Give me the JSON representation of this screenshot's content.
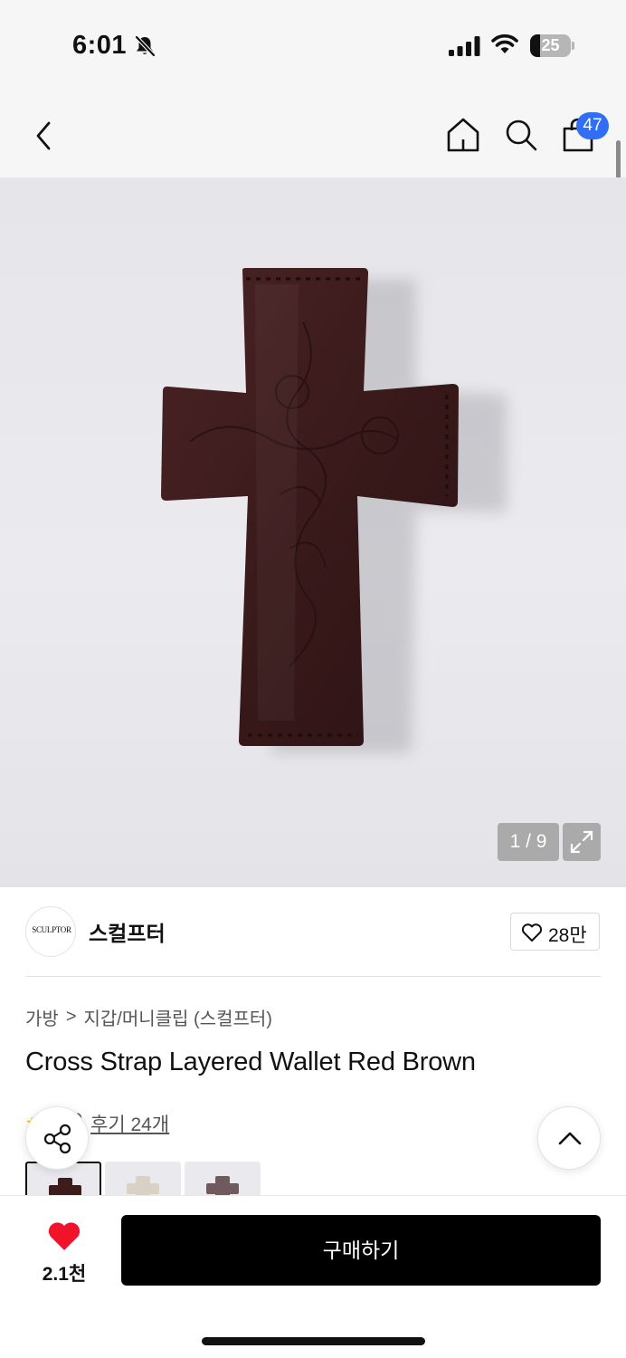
{
  "status_bar": {
    "time": "6:01",
    "battery_level": "25",
    "icons": [
      "bell-slash-icon",
      "cellular-signal-icon",
      "wifi-icon",
      "battery-icon"
    ]
  },
  "nav": {
    "icons": [
      "back-chevron-icon",
      "home-icon",
      "search-icon",
      "shopping-bag-icon"
    ],
    "cart_count": "47"
  },
  "gallery": {
    "pager": "1 / 9",
    "current_index": 1,
    "total": 9,
    "expand_icon": "expand-icon",
    "thumbnail_colors": [
      "#3e1c1c",
      "#d9d2c4",
      "#6f5a5e"
    ]
  },
  "brand": {
    "logo_text": "SCULPTOR",
    "name": "스컬프터",
    "likes": "28만",
    "like_icon": "heart-outline-icon"
  },
  "breadcrumb": {
    "category": "가방",
    "separator": ">",
    "subcategory": "지갑/머니클립 (스컬프터)"
  },
  "product": {
    "title": "Cross Strap Layered Wallet Red Brown",
    "reviews": "후기 24개",
    "rating": "5.0",
    "colors": {
      "leather": "#3a1a1b",
      "accent_blue": "#2f6ef5",
      "wish_red": "#f0132a"
    }
  },
  "bottom_bar": {
    "wish_count": "2.1천",
    "buy_label": "구매하기"
  }
}
